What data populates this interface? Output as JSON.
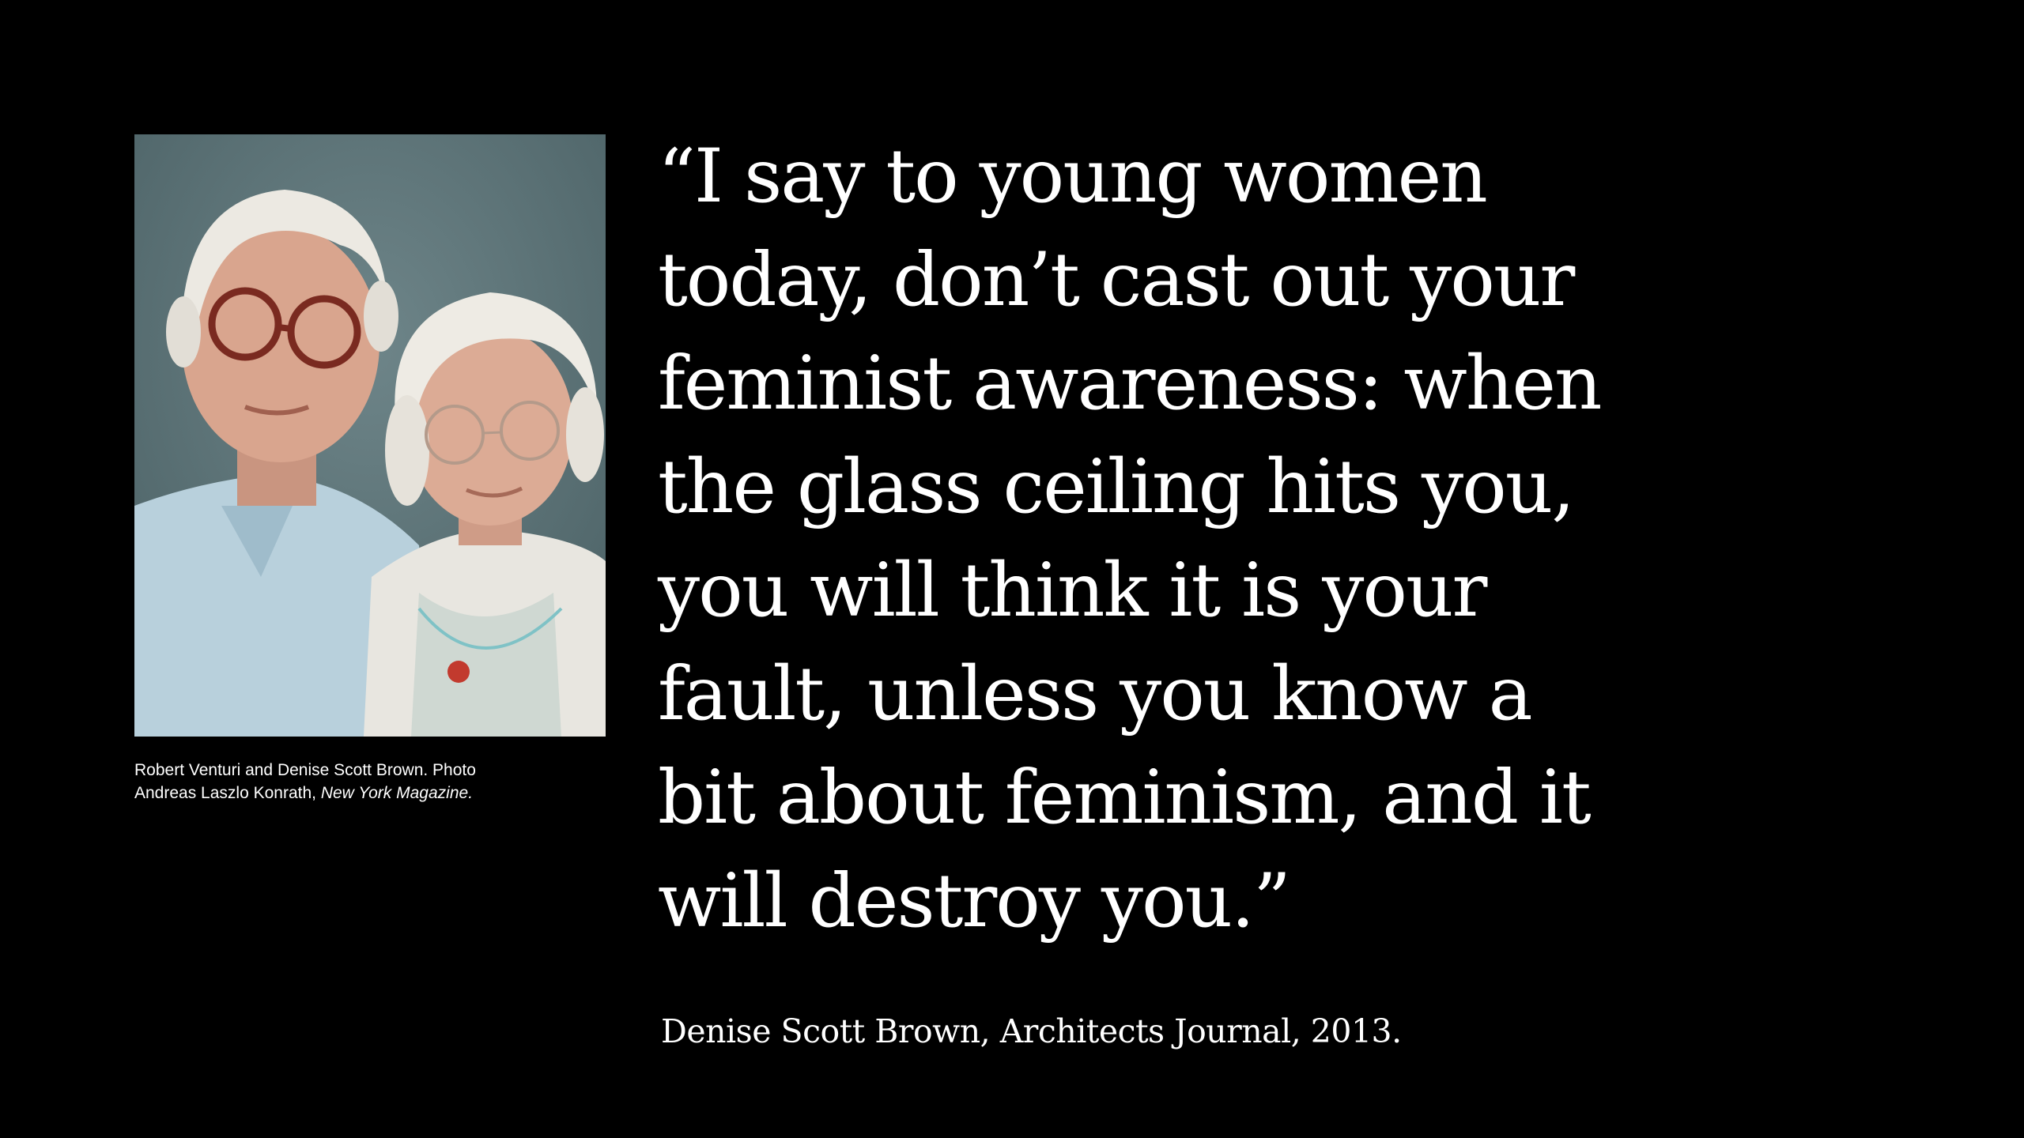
{
  "photo": {
    "icon": "portrait-photo-icon",
    "colors": {
      "background": "#5d7478",
      "shirt_left": "#b8d0dc",
      "shirt_right": "#e8e6e0",
      "skin": "#d9a58e",
      "hair": "#e9e6df",
      "glasses": "#7a2a20"
    }
  },
  "caption": {
    "line1": "Robert Venturi and Denise Scott Brown. Photo",
    "line2_prefix": "Andreas Laszlo Konrath, ",
    "line2_italic": "New York Magazine."
  },
  "quote": {
    "lines": [
      "“I say to young women",
      "today, don’t cast out your",
      "feminist awareness: when",
      "the glass ceiling hits you,",
      "you will think it is your",
      "fault, unless you know a",
      "bit about feminism, and it",
      "will destroy you.”"
    ]
  },
  "attribution": {
    "text": "Denise Scott Brown, Architects Journal, 2013."
  }
}
